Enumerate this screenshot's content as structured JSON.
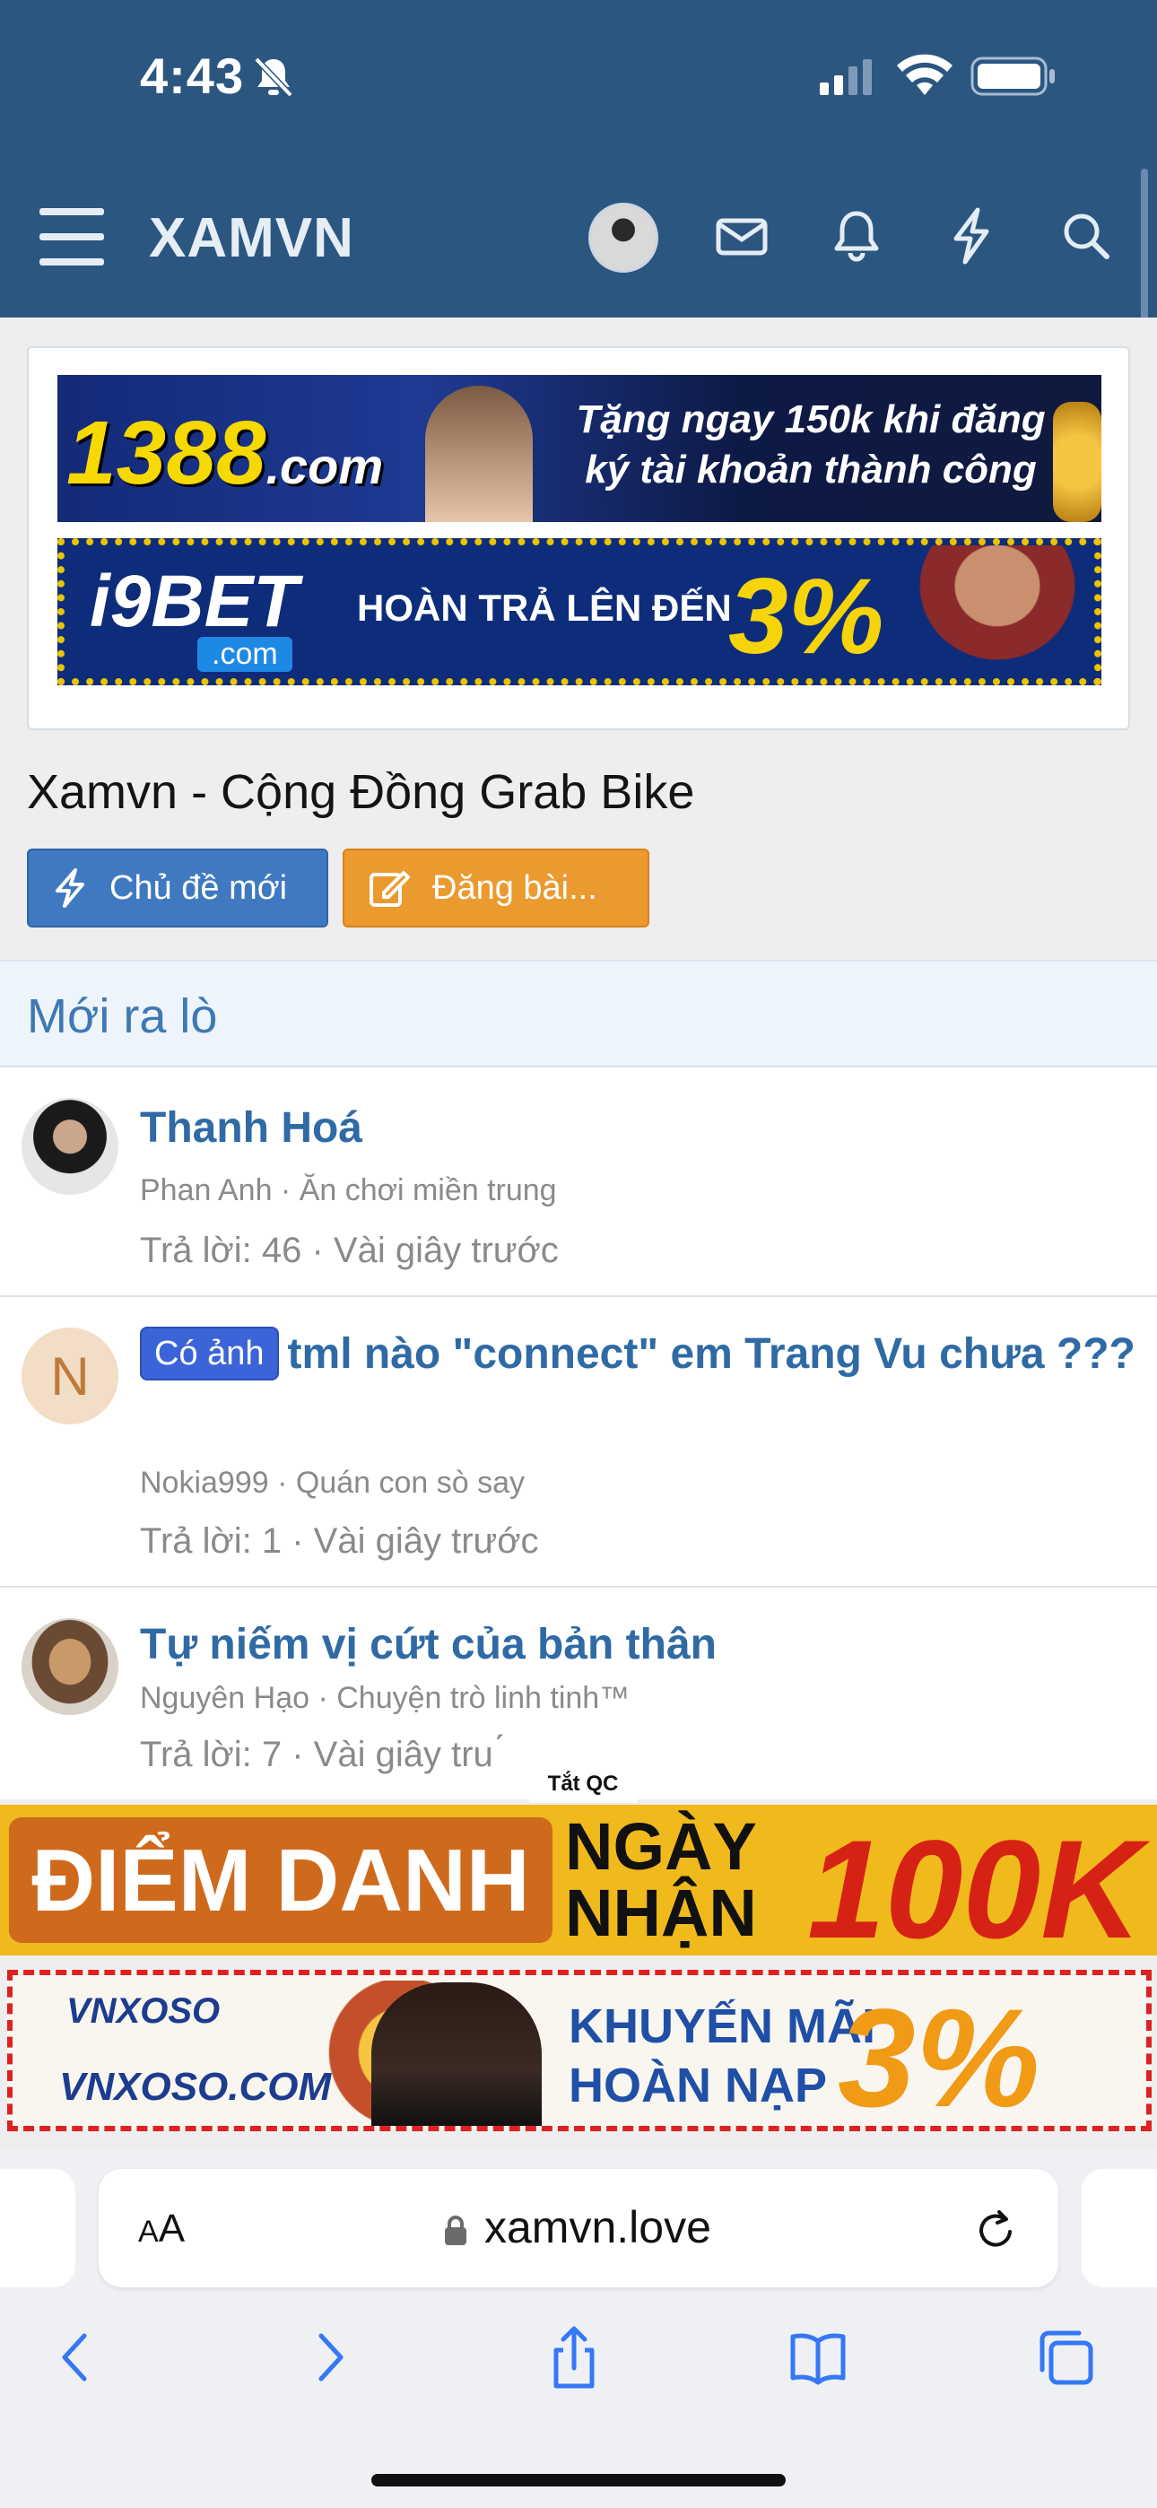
{
  "status_bar": {
    "time": "4:43"
  },
  "nav": {
    "brand": "XAMVN"
  },
  "ads_top": {
    "ad1_logo": "1388",
    "ad1_logo_suffix": ".com",
    "ad1_text": "Tặng ngay 150k khi đăng ký tài khoản thành công",
    "ad2_logo": "i9BET",
    "ad2_logo_sub": ".com",
    "ad2_text": "HOÀN TRẢ LÊN ĐẾN",
    "ad2_pct": "3%"
  },
  "forum": {
    "title": "Xamvn - Cộng Đồng Grab Bike",
    "new_topic_label": "Chủ đề mới",
    "post_label": "Đăng bài..."
  },
  "section": {
    "title": "Mới ra lò"
  },
  "threads": [
    {
      "title": "Thanh Hoá",
      "author": "Phan Anh",
      "forum": "Ăn chơi miền trung",
      "replies": "Trả lời: 46",
      "time": "Vài giây trước"
    },
    {
      "badge": "Có ảnh",
      "title": "tml nào \"connect\" em Trang Vu chưa ???",
      "avatar_letter": "N",
      "author": "Nokia999",
      "forum": "Quán con sò say",
      "replies": "Trả lời: 1",
      "time": "Vài giây trước"
    },
    {
      "title": "Tự niếm vị cứt của bản thân",
      "author": "Nguyên Hạo",
      "forum": "Chuyện trò linh tinh™",
      "replies": "Trả lời: 7",
      "time": "Vài giây tru ́"
    }
  ],
  "sep": " · ",
  "ads_bottom": {
    "close_label": "Tắt QC",
    "banner1_left": "ĐIỂM DANH MỖI",
    "banner1_mid_1": "NGÀY",
    "banner1_mid_2": "NHẬN",
    "banner1_right": "100K",
    "banner2_logo": "VNXOSO",
    "banner2_logo2": "VNXOSO.COM",
    "banner2_text_1": "KHUYẾN MÃI",
    "banner2_text_2": "HOÀN NẠP",
    "banner2_pct": "3%"
  },
  "safari": {
    "aa_small": "A",
    "aa_big": "A",
    "url": "xamvn.love"
  }
}
